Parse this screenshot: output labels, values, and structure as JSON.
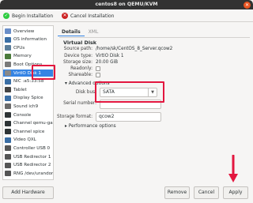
{
  "window": {
    "title": "centos8 on QEMU/KVM",
    "close_glyph": "✕"
  },
  "toolbar": {
    "begin_label": "Begin Installation",
    "cancel_label": "Cancel Installation",
    "begin_icon": "checkmark-icon",
    "cancel_icon": "cancel-icon"
  },
  "sidebar": {
    "items": [
      {
        "label": "Overview",
        "icon": "overview-icon",
        "color": "#6a8ec8"
      },
      {
        "label": "OS information",
        "icon": "os-info-icon",
        "color": "#3a6ea5"
      },
      {
        "label": "CPUs",
        "icon": "cpu-icon",
        "color": "#5a7d9a"
      },
      {
        "label": "Memory",
        "icon": "memory-icon",
        "color": "#4a7a3a"
      },
      {
        "label": "Boot Options",
        "icon": "boot-icon",
        "color": "#7a7a7a"
      },
      {
        "label": "VirtIO Disk 1",
        "icon": "disk-icon",
        "color": "#888888",
        "selected": true
      },
      {
        "label": "NIC :a5:33:58",
        "icon": "nic-icon",
        "color": "#3a6ea5"
      },
      {
        "label": "Tablet",
        "icon": "tablet-icon",
        "color": "#444444"
      },
      {
        "label": "Display Spice",
        "icon": "display-icon",
        "color": "#3a6ea5"
      },
      {
        "label": "Sound ich9",
        "icon": "sound-icon",
        "color": "#6a6a6a"
      },
      {
        "label": "Console",
        "icon": "console-icon",
        "color": "#2e3436"
      },
      {
        "label": "Channel qemu-ga",
        "icon": "channel-icon",
        "color": "#2e3436"
      },
      {
        "label": "Channel spice",
        "icon": "channel-icon",
        "color": "#2e3436"
      },
      {
        "label": "Video QXL",
        "icon": "video-icon",
        "color": "#3a6ea5"
      },
      {
        "label": "Controller USB 0",
        "icon": "controller-icon",
        "color": "#555555"
      },
      {
        "label": "USB Redirector 1",
        "icon": "usb-icon",
        "color": "#555555"
      },
      {
        "label": "USB Redirector 2",
        "icon": "usb-icon",
        "color": "#555555"
      },
      {
        "label": "RNG /dev/urandom",
        "icon": "rng-icon",
        "color": "#555555"
      }
    ],
    "add_hardware_label": "Add Hardware"
  },
  "tabs": [
    {
      "label": "Details",
      "active": true
    },
    {
      "label": "XML",
      "active": false
    }
  ],
  "virtual_disk": {
    "section_title": "Virtual Disk",
    "source_path_label": "Source path:",
    "source_path_value": "/home/sk/CentOS_8_Server.qcow2",
    "device_type_label": "Device type:",
    "device_type_value": "VirtIO Disk 1",
    "storage_size_label": "Storage size:",
    "storage_size_value": "20.00 GiB",
    "readonly_label": "Readonly:",
    "shareable_label": "Shareable:",
    "readonly_checked": false,
    "shareable_checked": false
  },
  "advanced": {
    "expander_label": "▾ Advanced options",
    "disk_bus_label": "Disk bus:",
    "disk_bus_value": "SATA",
    "serial_label": "Serial number:",
    "serial_value": "",
    "storage_format_label": "Storage format:",
    "storage_format_value": "qcow2"
  },
  "performance": {
    "expander_label": "▸ Performance options"
  },
  "buttons": {
    "remove_label": "Remove",
    "cancel_label": "Cancel",
    "apply_label": "Apply"
  },
  "highlight_color": "#e3173f",
  "accent_color": "#3584e4"
}
